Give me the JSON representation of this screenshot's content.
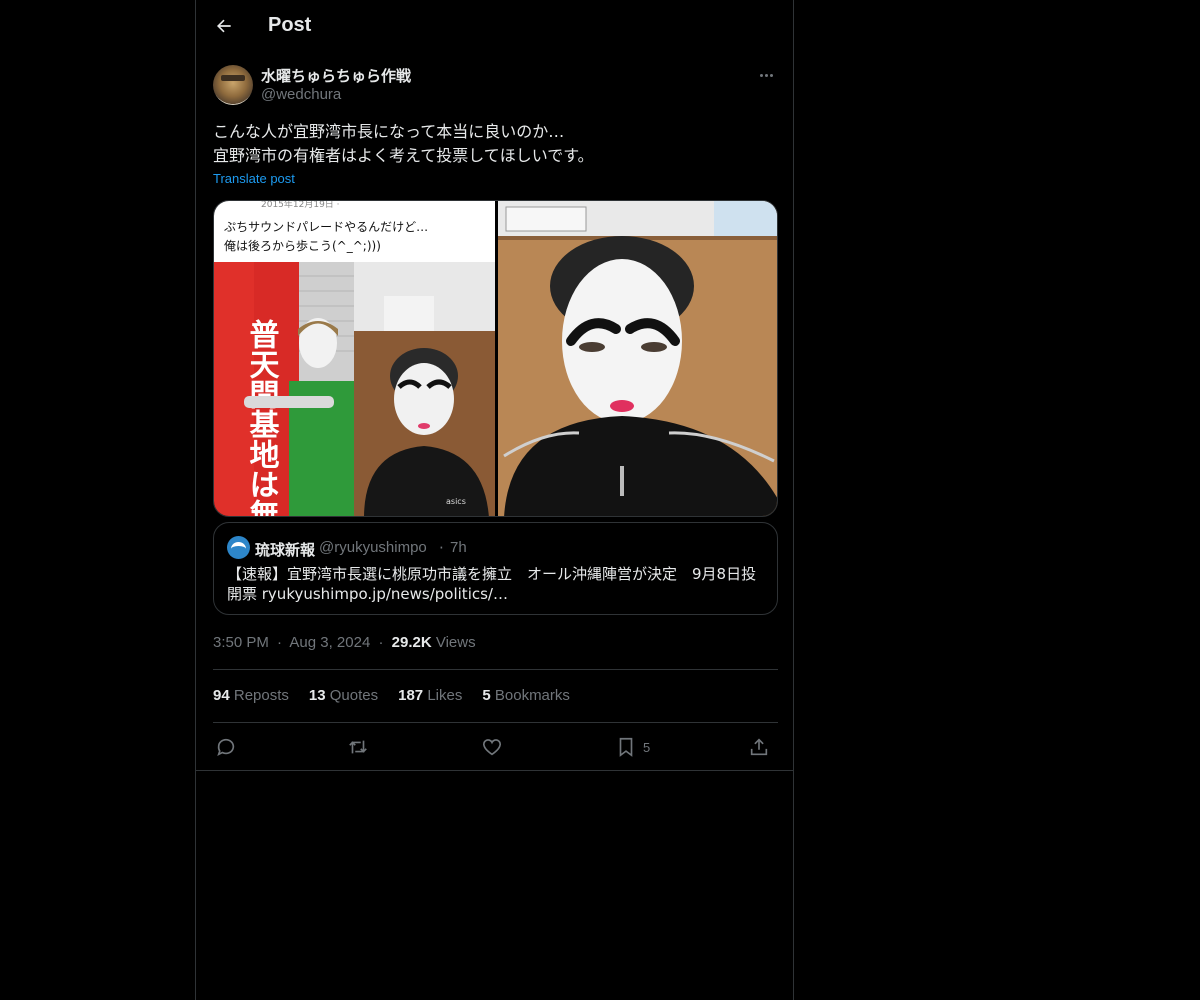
{
  "header": {
    "title": "Post",
    "back_icon": "arrow-left-icon"
  },
  "author": {
    "name": "水曜ちゅらちゅら作戦",
    "handle": "@wedchura"
  },
  "tweet": {
    "text": "こんな人が宜野湾市長になって本当に良いのか…\n宜野湾市の有権者はよく考えて投票してほしいです。",
    "translate_label": "Translate post"
  },
  "media": {
    "post_date": "2015年12月19日 ·",
    "caption_line1": "ぷちサウンドパレードやるんだけど…",
    "caption_line2": "俺は後ろから歩こう(^_^;)))",
    "banner_text": "普天間基地は無条件撤去",
    "shirt_logo": "asics"
  },
  "quote": {
    "name": "琉球新報",
    "handle": "@ryukyushimpo",
    "separator": "·",
    "time": "7h",
    "text": "【速報】宜野湾市長選に桃原功市議を擁立　オール沖縄陣営が決定　9月8日投開票 ryukyushimpo.jp/news/politics/…"
  },
  "meta": {
    "time": "3:50 PM",
    "separator": "·",
    "date": "Aug 3, 2024",
    "views_count": "29.2K",
    "views_label": "Views"
  },
  "stats": {
    "reposts_count": "94",
    "reposts_label": "Reposts",
    "quotes_count": "13",
    "quotes_label": "Quotes",
    "likes_count": "187",
    "likes_label": "Likes",
    "bookmarks_count": "5",
    "bookmarks_label": "Bookmarks"
  },
  "actions": {
    "bookmark_count": "5"
  },
  "colors": {
    "background": "#000000",
    "text": "#e7e9ea",
    "muted": "#71767b",
    "accent": "#1d9bf0",
    "border": "#2f3336"
  }
}
